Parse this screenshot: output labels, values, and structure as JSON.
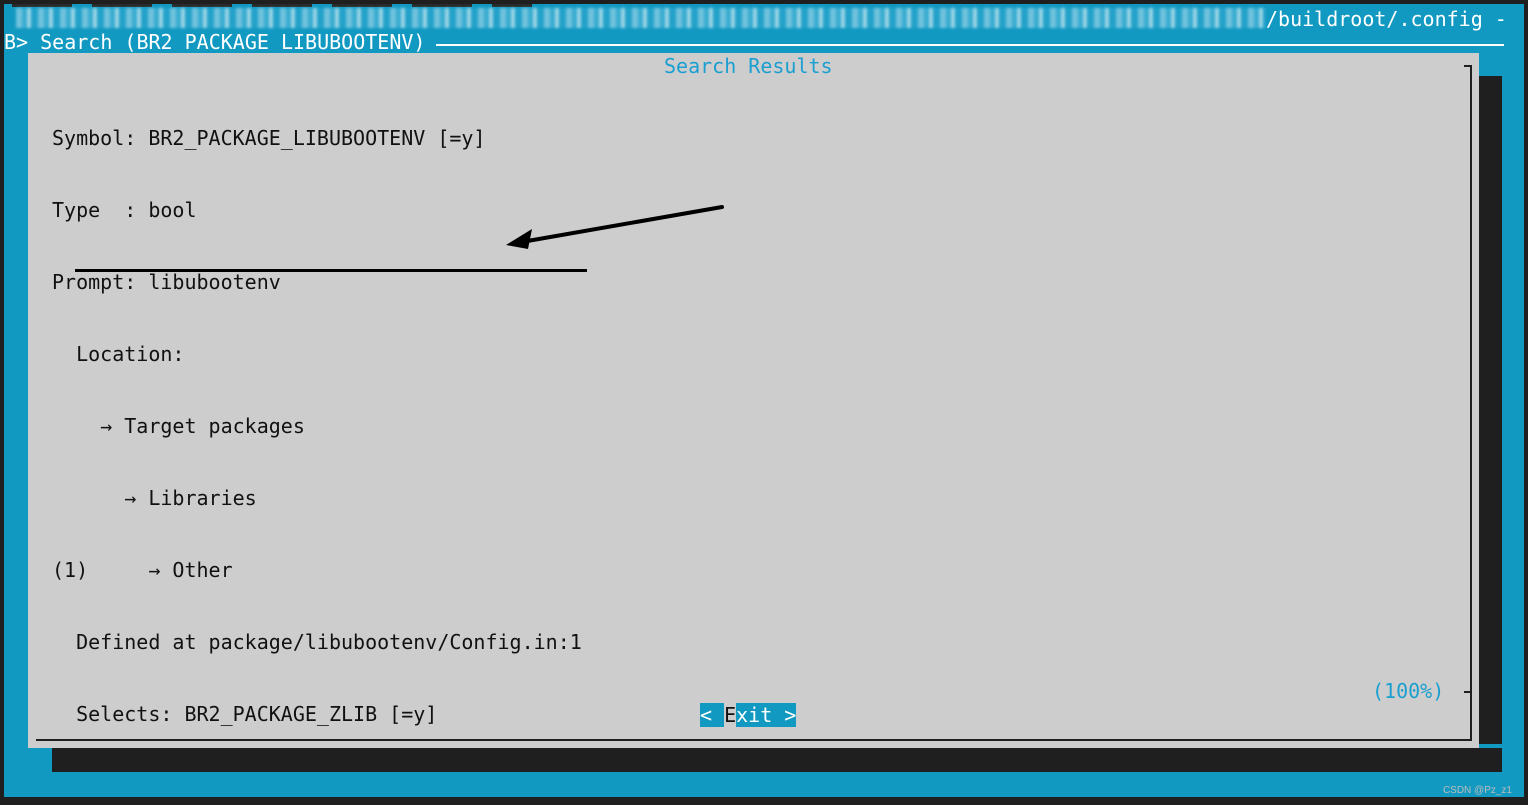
{
  "window": {
    "title_path": "/buildroot/.config -"
  },
  "backtitle": {
    "text": "B> Search (BR2_PACKAGE_LIBUBOOTENV)"
  },
  "dialog": {
    "title": "Search Results",
    "lines": [
      "Symbol: BR2_PACKAGE_LIBUBOOTENV [=y]",
      "Type  : bool",
      "Prompt: libubootenv",
      "  Location:",
      "    → Target packages",
      "      → Libraries",
      "(1)     → Other",
      "  Defined at package/libubootenv/Config.in:1",
      "  Selects: BR2_PACKAGE_ZLIB [=y]"
    ],
    "scroll_percent": "(100%)",
    "exit_button": {
      "left": "< ",
      "hotkey": "E",
      "rest": "xit >"
    }
  },
  "watermark": "CSDN @Pz_z1",
  "colors": {
    "background": "#1299c1",
    "dialog_bg": "#cdcdcd",
    "accent_text": "#1a9fd0",
    "shadow": "#1f1f1f"
  }
}
